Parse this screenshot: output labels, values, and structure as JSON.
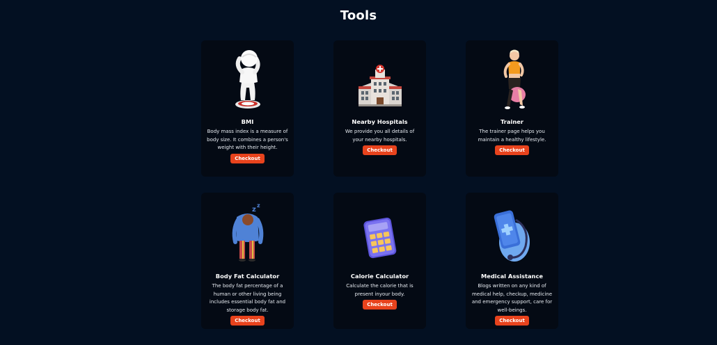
{
  "section": {
    "title": "Tools"
  },
  "cards": [
    {
      "name": "BMI",
      "icon": "weighing-person-icon",
      "description": "Body mass index is a measure of body size. It combines a person's weight with their height.",
      "button": "Checkout"
    },
    {
      "name": "Nearby Hospitals",
      "icon": "hospital-icon",
      "description": "We provide you all details of your nearby hospitals.",
      "button": "Checkout"
    },
    {
      "name": "Trainer",
      "icon": "trainer-icon",
      "description": "The trainer page helps you maintain a healthy lifestyle.",
      "button": "Checkout"
    },
    {
      "name": "Body Fat Calculator",
      "icon": "tired-person-icon",
      "description": "The body fat percentage of a human or other living being includes essential body fat and storage body fat.",
      "button": "Checkout"
    },
    {
      "name": "Calorie Calculator",
      "icon": "calculator-icon",
      "description": "Calculate the calorie that is present inyour body.",
      "button": "Checkout"
    },
    {
      "name": "Medical Assistance",
      "icon": "medical-phone-icon",
      "description": "Blogs written on any kind of medical help, checkup, medicine and emergency support, care for well-beings.",
      "button": "Checkout"
    }
  ],
  "colors": {
    "background": "#031022",
    "card": "#040a14",
    "button": "#e8431d"
  }
}
